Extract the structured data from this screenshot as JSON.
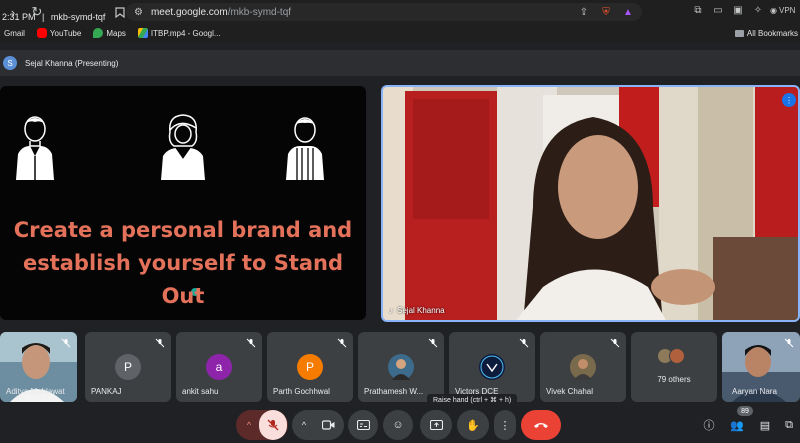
{
  "browser": {
    "url_host": "meet.google.com",
    "url_path": "/mkb-symd-tqf",
    "vpn_label": "VPN"
  },
  "bookmarks": [
    {
      "label": "Gmail",
      "icon": "gmail-icon",
      "color": "#ea4335"
    },
    {
      "label": "YouTube",
      "icon": "youtube-icon",
      "color": "#ff0000"
    },
    {
      "label": "Maps",
      "icon": "maps-icon",
      "color": "#34a853"
    },
    {
      "label": "ITBP.mp4 - Googl...",
      "icon": "drive-icon",
      "color": "#fbbc04"
    }
  ],
  "bookmarks_right": "All Bookmarks",
  "presenter": {
    "initial": "S",
    "label": "Sejal Khanna (Presenting)"
  },
  "slide": {
    "line1": "Create a personal brand and",
    "line2": "establish yourself to Stand",
    "line3": "Out"
  },
  "speaker": {
    "name": "Sejal Khanna"
  },
  "participants": [
    {
      "name": "Aditya Mahlawat",
      "type": "video"
    },
    {
      "name": "PANKAJ",
      "initial": "P",
      "color": "#5f6368"
    },
    {
      "name": "ankit sahu",
      "initial": "a",
      "color": "#8e24aa"
    },
    {
      "name": "Parth Gochhwal",
      "initial": "P",
      "color": "#f57c00"
    },
    {
      "name": "Prathamesh W...",
      "type": "photo"
    },
    {
      "name": "Victors DCE",
      "type": "logo"
    },
    {
      "name": "Vivek Chahal",
      "type": "photo2"
    },
    {
      "name": "79 others",
      "type": "others"
    },
    {
      "name": "Aaryan Nara",
      "type": "video2"
    }
  ],
  "meeting": {
    "time": "2:31 PM",
    "separator": "|",
    "code": "mkb-symd-tqf"
  },
  "tooltip": "Raise hand (ctrl + ⌘ + h)",
  "people_count": "89",
  "colors": {
    "accent": "#8ab4f8",
    "end_call": "#ea4335",
    "mic_off": "#f9dedc",
    "slide_text": "#e4715a"
  }
}
